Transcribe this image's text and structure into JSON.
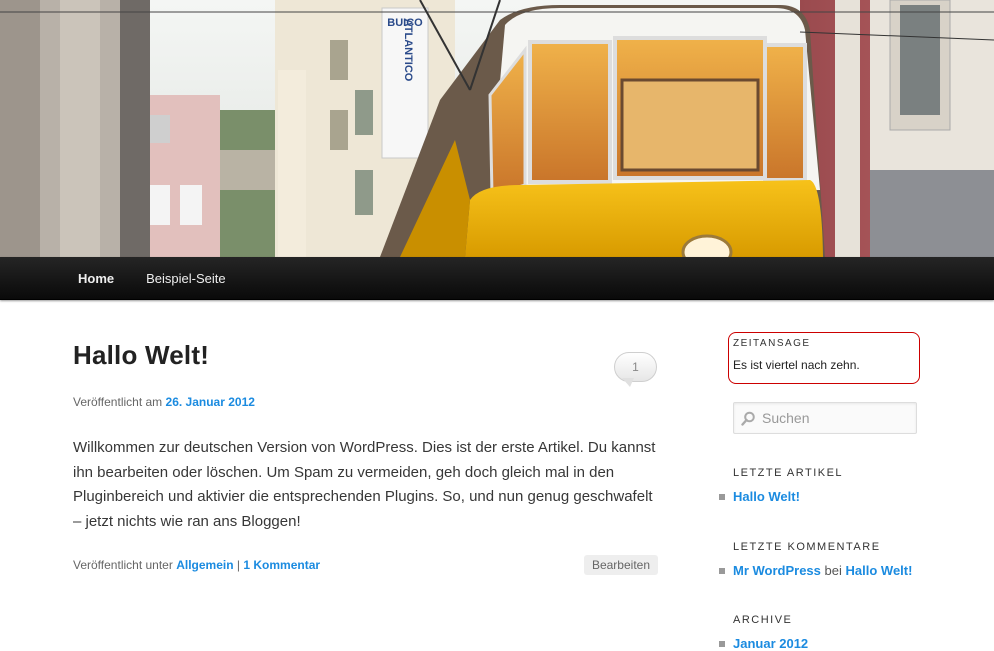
{
  "nav": {
    "items": [
      {
        "label": "Home",
        "active": true
      },
      {
        "label": "Beispiel-Seite",
        "active": false
      }
    ]
  },
  "header_image": {
    "sign_lines": [
      "BUICO",
      "ATLANTICO"
    ],
    "description_icon": "tram-street-photo"
  },
  "post": {
    "title": "Hallo Welt!",
    "comment_count": "1",
    "meta_prefix": "Veröffentlicht am",
    "date": "26. Januar 2012",
    "content": "Willkommen zur deutschen Version von WordPress. Dies ist der erste Artikel. Du kannst ihn bearbeiten oder löschen. Um Spam zu vermeiden, geh doch gleich mal in den Pluginbereich und aktivier die entsprechenden Plugins. So, und nun genug geschwafelt – jetzt nichts wie ran ans Bloggen!",
    "footer_prefix": "Veröffentlicht unter",
    "category": "Allgemein",
    "separator": "|",
    "comments_link": "1 Kommentar",
    "edit_label": "Bearbeiten"
  },
  "sidebar": {
    "time_widget": {
      "title": "ZEITANSAGE",
      "text": "Es ist viertel nach zehn."
    },
    "search": {
      "placeholder": "Suchen",
      "icon": "search-icon"
    },
    "recent_posts": {
      "title": "LETZTE ARTIKEL",
      "items": [
        "Hallo Welt!"
      ]
    },
    "recent_comments": {
      "title": "LETZTE KOMMENTARE",
      "author": "Mr WordPress",
      "connector": "bei",
      "post": "Hallo Welt!"
    },
    "archives": {
      "title": "ARCHIVE",
      "items": [
        "Januar 2012"
      ]
    }
  },
  "colors": {
    "link": "#1b8be0",
    "nav_bg": "#111111",
    "tram_yellow": "#f2b705",
    "widget_border": "#cc0000"
  }
}
